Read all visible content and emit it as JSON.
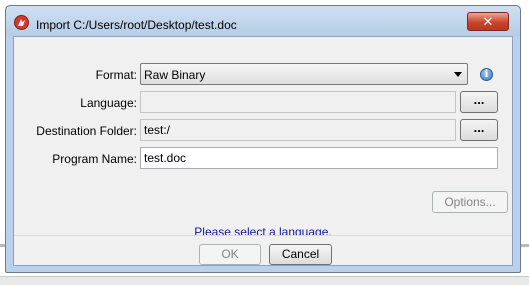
{
  "window": {
    "title": "Import C:/Users/root/Desktop/test.doc",
    "close_glyph": "✕"
  },
  "form": {
    "format_label": "Format:",
    "format_value": "Raw Binary",
    "language_label": "Language:",
    "language_value": "",
    "language_browse": "...",
    "destination_label": "Destination Folder:",
    "destination_value": "test:/",
    "destination_browse": "...",
    "program_label": "Program Name:",
    "program_value": "test.doc"
  },
  "options_label": "Options...",
  "status_message": "Please select a language.",
  "footer": {
    "ok_label": "OK",
    "cancel_label": "Cancel"
  },
  "icons": {
    "app": "dragon-logo-icon",
    "info": "info-icon",
    "dropdown": "chevron-down-icon"
  },
  "colors": {
    "status_text": "#1414a0",
    "close_button": "#c8452c",
    "title_bar": "#b9d1ea"
  }
}
